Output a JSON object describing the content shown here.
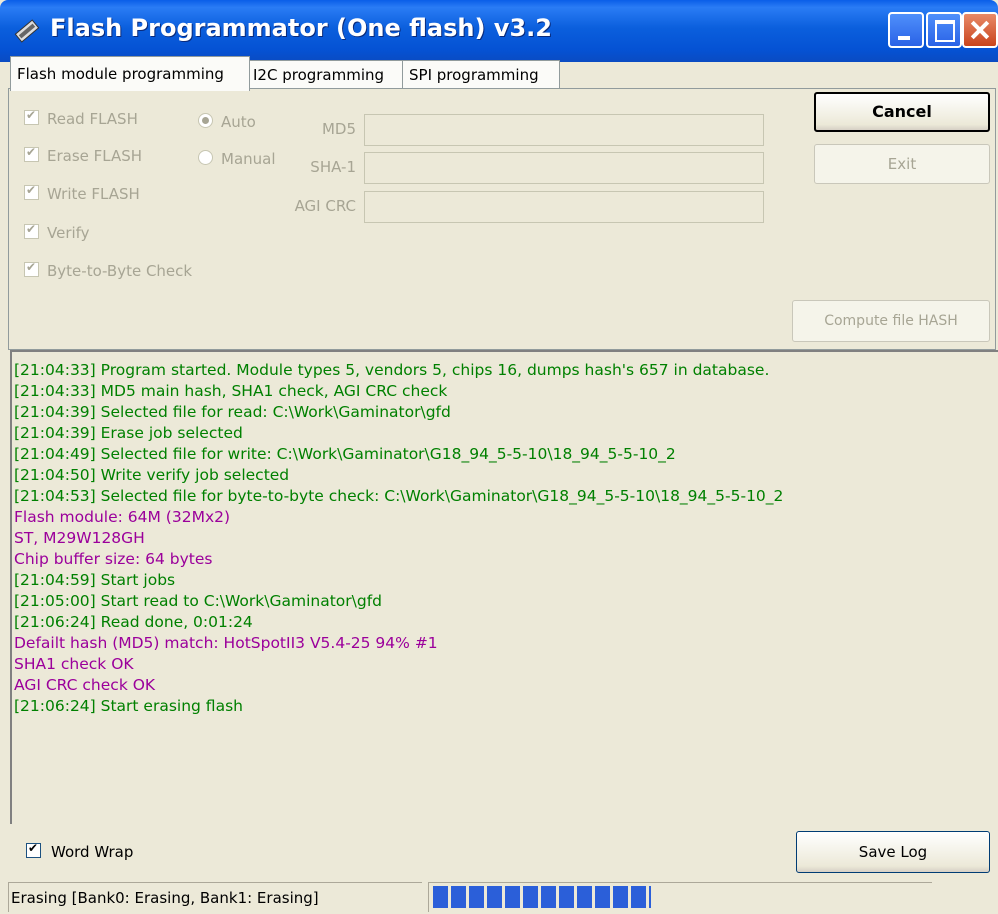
{
  "window": {
    "title": "Flash Programmator (One flash) v3.2"
  },
  "tabs": [
    "Flash module programming",
    "I2C programming",
    "SPI programming"
  ],
  "options": {
    "checkboxes": [
      "Read FLASH",
      "Erase FLASH",
      "Write FLASH",
      "Verify",
      "Byte-to-Byte Check"
    ],
    "radios": [
      "Auto",
      "Manual"
    ],
    "hash_labels": [
      "MD5",
      "SHA-1",
      "AGI CRC"
    ]
  },
  "buttons": {
    "cancel": "Cancel",
    "exit": "Exit",
    "compute_hash": "Compute file HASH",
    "save_log": "Save Log"
  },
  "log": [
    {
      "text": "[21:04:33] Program started. Module types 5, vendors 5, chips 16, dumps hash's 657 in database.",
      "color": "green"
    },
    {
      "text": "[21:04:33] MD5 main hash, SHA1 check, AGI CRC check",
      "color": "green"
    },
    {
      "text": "[21:04:39] Selected file for read: C:\\Work\\Gaminator\\gfd",
      "color": "green"
    },
    {
      "text": "[21:04:39] Erase job selected",
      "color": "green"
    },
    {
      "text": "[21:04:49] Selected file for write: C:\\Work\\Gaminator\\G18_94_5-5-10\\18_94_5-5-10_2",
      "color": "green"
    },
    {
      "text": "[21:04:50] Write verify job selected",
      "color": "green"
    },
    {
      "text": "[21:04:53] Selected file for byte-to-byte check: C:\\Work\\Gaminator\\G18_94_5-5-10\\18_94_5-5-10_2",
      "color": "green"
    },
    {
      "text": "Flash module: 64M (32Mx2)",
      "color": "purple"
    },
    {
      "text": "ST, M29W128GH",
      "color": "purple"
    },
    {
      "text": "Chip buffer size: 64 bytes",
      "color": "purple"
    },
    {
      "text": "[21:04:59] Start jobs",
      "color": "green"
    },
    {
      "text": "[21:05:00] Start read to C:\\Work\\Gaminator\\gfd",
      "color": "green"
    },
    {
      "text": "[21:06:24] Read done, 0:01:24",
      "color": "green"
    },
    {
      "text": "Defailt hash (MD5) match: HotSpotII3 V5.4-25 94% #1",
      "color": "purple"
    },
    {
      "text": "SHA1 check OK",
      "color": "purple"
    },
    {
      "text": "AGI CRC check OK",
      "color": "purple"
    },
    {
      "text": "[21:06:24] Start erasing flash",
      "color": "green"
    }
  ],
  "word_wrap": {
    "label": "Word Wrap",
    "checked": true
  },
  "status": {
    "text": "Erasing [Bank0: Erasing, Bank1: Erasing]",
    "progress": 0.44
  },
  "colors": {
    "log_green": "#008000",
    "log_purple": "#9b009b",
    "title_bar": "#0a5ee8",
    "progress": "#2b5fd9"
  }
}
